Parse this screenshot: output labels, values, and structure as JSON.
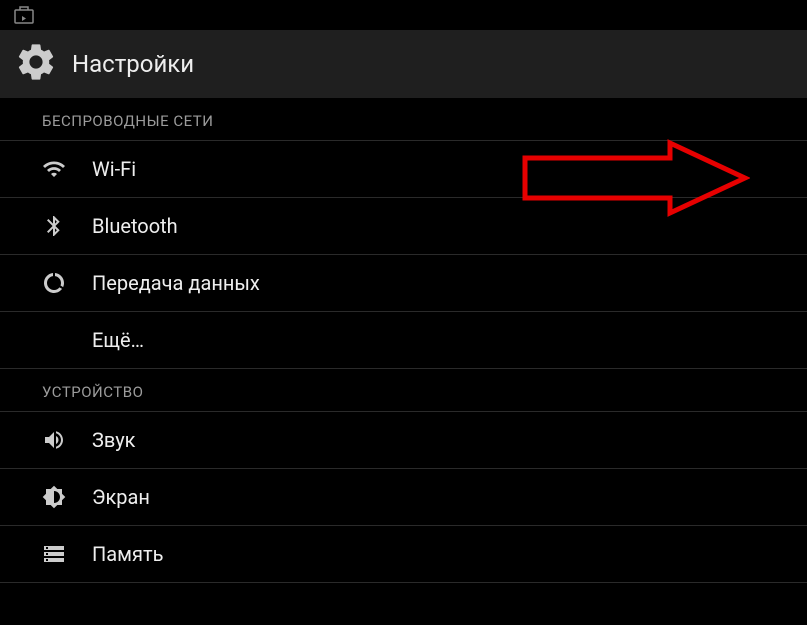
{
  "header": {
    "title": "Настройки"
  },
  "sections": {
    "wireless": {
      "label": "БЕСПРОВОДНЫЕ СЕТИ",
      "items": {
        "wifi": "Wi-Fi",
        "bluetooth": "Bluetooth",
        "data": "Передача данных",
        "more": "Ещё…"
      }
    },
    "device": {
      "label": "УСТРОЙСТВО",
      "items": {
        "sound": "Звук",
        "display": "Экран",
        "storage": "Память"
      }
    }
  }
}
